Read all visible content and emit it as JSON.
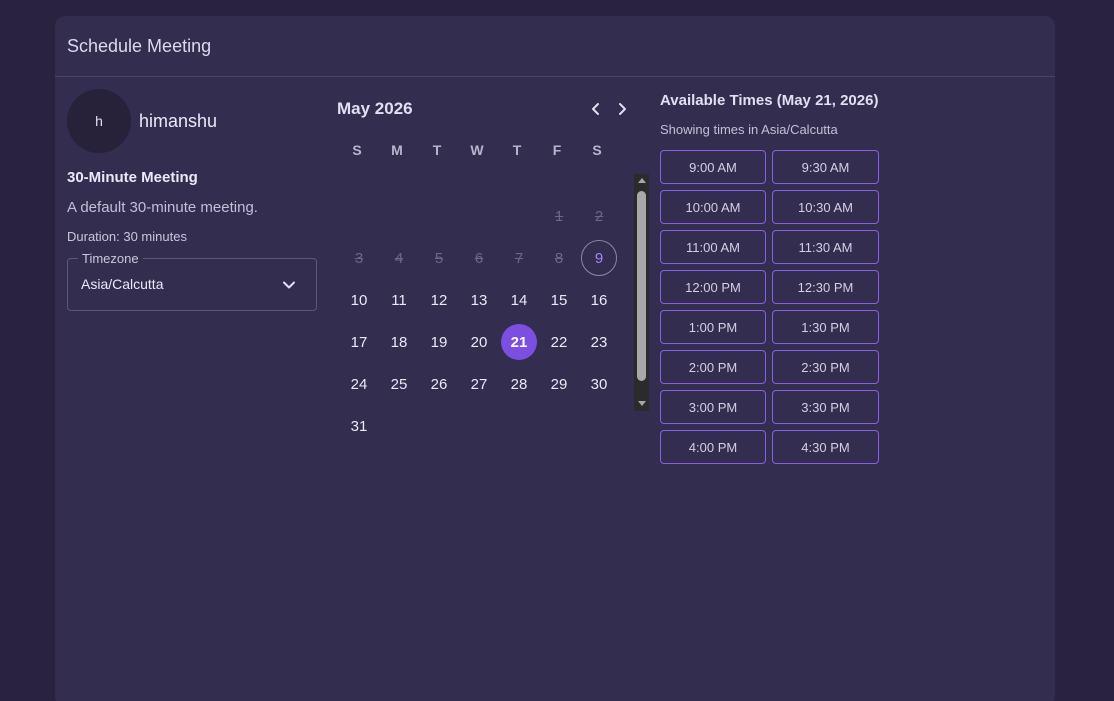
{
  "header": {
    "title": "Schedule Meeting"
  },
  "host": {
    "initial": "h",
    "name": "himanshu"
  },
  "meeting": {
    "title": "30-Minute Meeting",
    "description": "A default 30-minute meeting.",
    "duration": "Duration: 30 minutes"
  },
  "timezone": {
    "label": "Timezone",
    "value": "Asia/Calcutta"
  },
  "calendar": {
    "month_label": "May 2026",
    "weekdays": [
      "S",
      "M",
      "T",
      "W",
      "T",
      "F",
      "S"
    ],
    "first_weekday_index": 5,
    "days_in_month": 31,
    "disabled_until": 8,
    "today": 9,
    "selected": 21
  },
  "times": {
    "title": "Available Times (May 21, 2026)",
    "subtitle": "Showing times in Asia/Calcutta",
    "slots": [
      "9:00 AM",
      "9:30 AM",
      "10:00 AM",
      "10:30 AM",
      "11:00 AM",
      "11:30 AM",
      "12:00 PM",
      "12:30 PM",
      "1:00 PM",
      "1:30 PM",
      "2:00 PM",
      "2:30 PM",
      "3:00 PM",
      "3:30 PM",
      "4:00 PM",
      "4:30 PM"
    ]
  },
  "icons": {
    "nav_prev": "chevron-left-icon",
    "nav_next": "chevron-right-icon",
    "dropdown": "chevron-down-icon"
  },
  "colors": {
    "accent": "#7c4fe0",
    "slot_border": "#8a5ee6",
    "card_bg": "#332d4f",
    "page_bg": "#2a2340"
  }
}
